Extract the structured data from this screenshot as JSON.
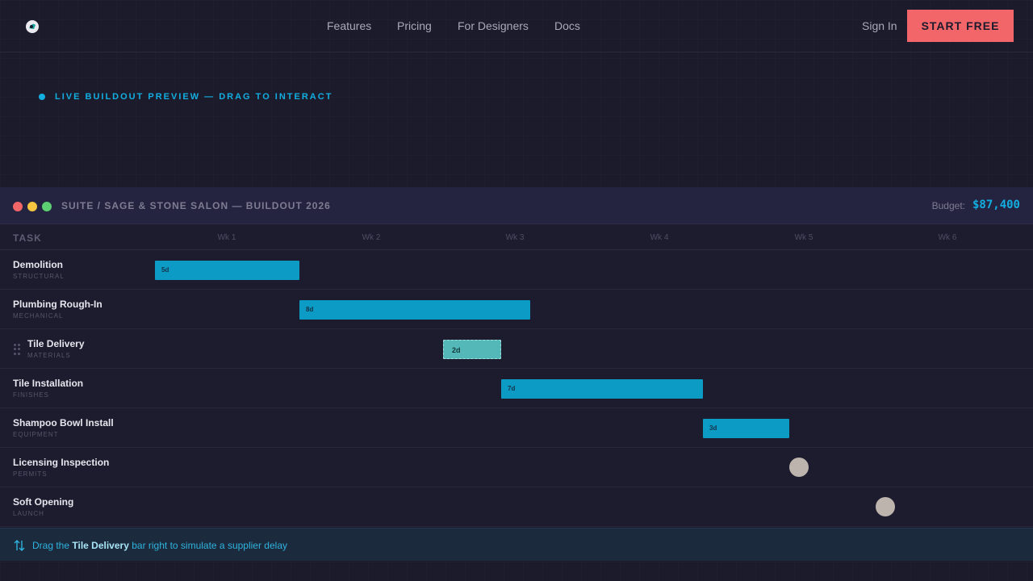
{
  "nav": {
    "links": [
      "Features",
      "Pricing",
      "For Designers",
      "Docs"
    ],
    "sign_in": "Sign In",
    "cta": "START FREE"
  },
  "eyebrow": "LIVE BUILDOUT PREVIEW — DRAG TO INTERACT",
  "window": {
    "title": "SUITE / SAGE & STONE SALON — BUILDOUT 2026",
    "budget_label": "Budget:",
    "budget_value": "$87,400"
  },
  "gantt": {
    "task_header": "TASK",
    "weeks": [
      "Wk 1",
      "Wk 2",
      "Wk 3",
      "Wk 4",
      "Wk 5",
      "Wk 6"
    ],
    "tasks": [
      {
        "name": "Demolition",
        "category": "STRUCTURAL",
        "duration": "5d",
        "kind": "bar"
      },
      {
        "name": "Plumbing Rough-In",
        "category": "MECHANICAL",
        "duration": "8d",
        "kind": "bar"
      },
      {
        "name": "Tile Delivery",
        "category": "MATERIALS",
        "duration": "2d",
        "kind": "draggable"
      },
      {
        "name": "Tile Installation",
        "category": "FINISHES",
        "duration": "7d",
        "kind": "bar"
      },
      {
        "name": "Shampoo Bowl Install",
        "category": "EQUIPMENT",
        "duration": "3d",
        "kind": "bar"
      },
      {
        "name": "Licensing Inspection",
        "category": "PERMITS",
        "duration": "",
        "kind": "milestone"
      },
      {
        "name": "Soft Opening",
        "category": "LAUNCH",
        "duration": "",
        "kind": "milestone"
      }
    ]
  },
  "hint": {
    "prefix": "Drag the",
    "task": "Tile Delivery",
    "suffix": "bar right to simulate a supplier delay"
  },
  "colors": {
    "accent": "#12aee0",
    "cta": "#f2666a",
    "bar": "#0b9bc4",
    "draggable_bar": "#54b8b8",
    "milestone": "#bdb5ad"
  }
}
